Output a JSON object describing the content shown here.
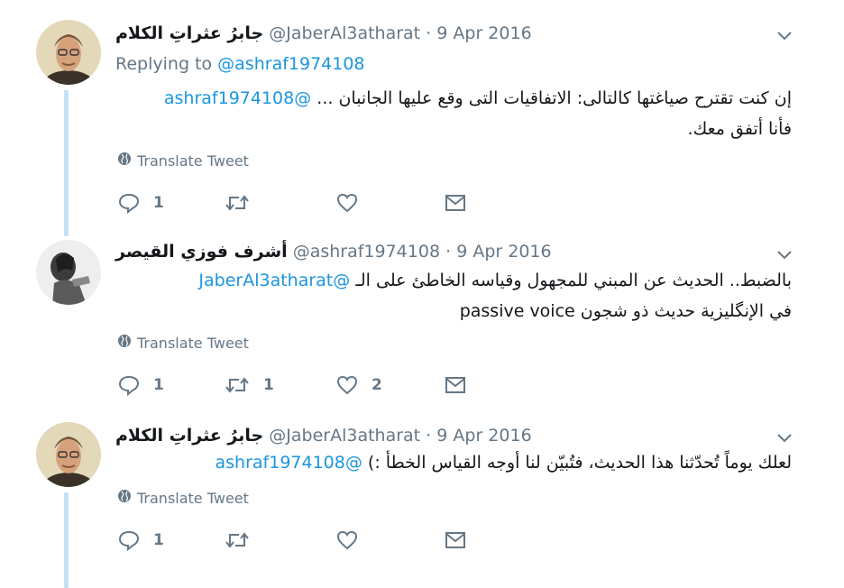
{
  "tweets": [
    {
      "name": "جابرُ عثراتِ الكلام",
      "handle": "@JaberAl3atharat",
      "dot": "·",
      "date": "9 Apr 2016",
      "replying_prefix": "Replying to",
      "replying_to": "@ashraf1974108",
      "mention": "@ashraf1974108",
      "text_line1": "إن كنت تقترح صياغتها كالتالى: الاتفاقيات التى وقع عليها الجانبان ...",
      "text_line2": "فأنا أتفق معك.",
      "translate": "Translate Tweet",
      "reply_count": "1",
      "retweet_count": "",
      "like_count": ""
    },
    {
      "name": "أشرف فوزي القيصر",
      "handle": "@ashraf1974108",
      "dot": "·",
      "date": "9 Apr 2016",
      "mention": "@JaberAl3atharat",
      "text_line1": "بالضبط.. الحديث عن المبني للمجهول وقياسه الخاطئ على الـ",
      "text_line2_rtl": "في الإنگليزية حديث ذو شجون",
      "text_line2_ltr": "passive voice",
      "translate": "Translate Tweet",
      "reply_count": "1",
      "retweet_count": "1",
      "like_count": "2"
    },
    {
      "name": "جابرُ عثراتِ الكلام",
      "handle": "@JaberAl3atharat",
      "dot": "·",
      "date": "9 Apr 2016",
      "mention": "@ashraf1974108",
      "text_line1": "لعلك يوماً تُحدّثنا هذا الحديث، فتُبيّن لنا أوجه القياس الخطأ :)",
      "translate": "Translate Tweet",
      "reply_count": "1",
      "retweet_count": "",
      "like_count": ""
    }
  ],
  "colors": {
    "link": "#1b95e0",
    "secondary_text": "#657786",
    "thread_line": "#c4e2f7"
  },
  "icons": [
    "globe-icon",
    "reply-icon",
    "retweet-icon",
    "like-icon",
    "direct-message-icon",
    "chevron-down-icon"
  ]
}
